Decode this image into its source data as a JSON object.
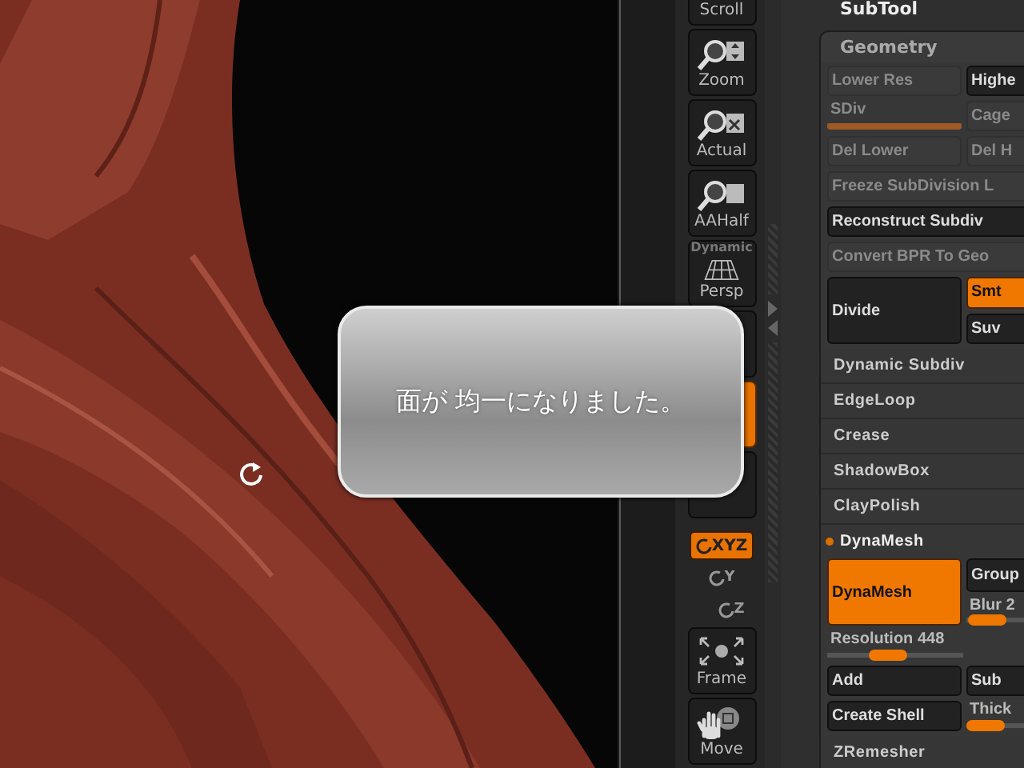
{
  "popup": {
    "message": "面が 均一になりました。"
  },
  "shelf": [
    {
      "kind": "scroll",
      "label": "Scroll"
    },
    {
      "kind": "zoom",
      "label": "Zoom"
    },
    {
      "kind": "actual",
      "label": "Actual"
    },
    {
      "kind": "aahalf",
      "label": "AAHalf"
    },
    {
      "kind": "persp",
      "label": "Persp",
      "caption": "Dynamic"
    },
    {
      "kind": "blank",
      "selected": false
    },
    {
      "kind": "blank",
      "selected": true
    },
    {
      "kind": "blank",
      "selected": false
    },
    {
      "kind": "toggle",
      "label": "XYZ",
      "selected": true
    },
    {
      "kind": "axis",
      "label": "Y"
    },
    {
      "kind": "axis",
      "label": "Z"
    },
    {
      "kind": "frame",
      "label": "Frame"
    },
    {
      "kind": "move",
      "label": "Move"
    }
  ],
  "panel": {
    "title": "SubTool",
    "section": {
      "title": "Geometry",
      "rows": [
        {
          "kind": "pair",
          "cells": [
            {
              "kind": "button",
              "label": "Lower Res",
              "disabled": true,
              "selected": false
            },
            {
              "kind": "button",
              "label": "Highe",
              "disabled": false,
              "selected": false
            }
          ]
        },
        {
          "kind": "pair",
          "cells": [
            {
              "kind": "slider",
              "label": "SDiv",
              "disabled": true,
              "level": 1
            },
            {
              "kind": "button",
              "label": "Cage",
              "disabled": true,
              "selected": false
            }
          ]
        },
        {
          "kind": "pair",
          "cells": [
            {
              "kind": "button",
              "label": "Del Lower",
              "disabled": true,
              "selected": false
            },
            {
              "kind": "button",
              "label": "Del H",
              "disabled": true,
              "selected": false
            }
          ]
        },
        {
          "kind": "wide",
          "cell": {
            "kind": "button",
            "label": "Freeze SubDivision L",
            "disabled": true,
            "selected": false
          }
        },
        {
          "kind": "wide",
          "cell": {
            "kind": "button",
            "label": "Reconstruct Subdiv",
            "disabled": false,
            "selected": false
          }
        },
        {
          "kind": "wide",
          "cell": {
            "kind": "button",
            "label": "Convert BPR To Geo",
            "disabled": true,
            "selected": false
          }
        },
        {
          "kind": "big",
          "main": {
            "kind": "button",
            "label": "Divide",
            "disabled": false,
            "selected": false
          },
          "side": [
            {
              "kind": "button",
              "label": "Smt",
              "disabled": false,
              "selected": true
            },
            {
              "kind": "button",
              "label": "Suv",
              "disabled": false,
              "selected": false
            }
          ]
        },
        {
          "kind": "item",
          "label": "Dynamic Subdiv",
          "expanded": false
        },
        {
          "kind": "item",
          "label": "EdgeLoop",
          "expanded": false
        },
        {
          "kind": "item",
          "label": "Crease",
          "expanded": false
        },
        {
          "kind": "item",
          "label": "ShadowBox",
          "expanded": false
        },
        {
          "kind": "item",
          "label": "ClayPolish",
          "expanded": false
        },
        {
          "kind": "item",
          "label": "DynaMesh",
          "expanded": true
        },
        {
          "kind": "big",
          "main": {
            "kind": "button",
            "label": "DynaMesh",
            "disabled": false,
            "selected": true
          },
          "side": [
            {
              "kind": "button",
              "label": "Group",
              "disabled": false,
              "selected": false
            },
            {
              "kind": "slider",
              "label": "Blur 2",
              "disabled": false,
              "level": 0.05
            }
          ]
        },
        {
          "kind": "wide",
          "cell": {
            "kind": "slider",
            "label": "Resolution 448",
            "disabled": false,
            "level": 0.42
          }
        },
        {
          "kind": "pair",
          "cells": [
            {
              "kind": "button",
              "label": "Add",
              "disabled": false,
              "selected": false
            },
            {
              "kind": "button",
              "label": "Sub",
              "disabled": false,
              "selected": false
            }
          ]
        },
        {
          "kind": "pair",
          "cells": [
            {
              "kind": "button",
              "label": "Create Shell",
              "disabled": false,
              "selected": false
            },
            {
              "kind": "slider",
              "label": "Thick",
              "disabled": false,
              "level": 0
            }
          ]
        },
        {
          "kind": "item",
          "label": "ZRemesher",
          "expanded": false
        }
      ]
    }
  }
}
